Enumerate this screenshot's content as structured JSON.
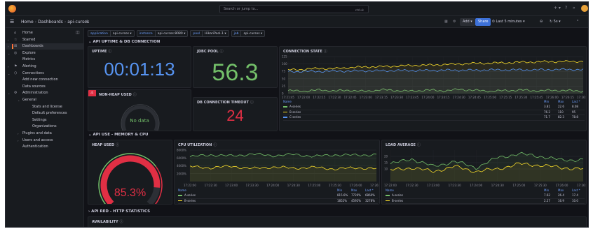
{
  "topbar": {
    "search_placeholder": "Search or jump to...",
    "search_shortcut": "ctrl+k",
    "help_label": "?",
    "news_label": "»"
  },
  "breadcrumb": {
    "home": "Home",
    "dashboards": "Dashboards",
    "current": "api-cursos"
  },
  "toolbar": {
    "add_label": "Add ▾",
    "share_label": "Share",
    "time_range": "Last 5 minutes ▾",
    "refresh_label": "5s ▾"
  },
  "sidebar": {
    "items": [
      {
        "label": "Home",
        "icon": "home-icon",
        "glyph": "⌂",
        "chev": ""
      },
      {
        "label": "Starred",
        "icon": "star-icon",
        "glyph": "☆",
        "chev": "›"
      },
      {
        "label": "Dashboards",
        "icon": "dashboards-icon",
        "glyph": "⊞",
        "chev": "›",
        "active": true
      },
      {
        "label": "Explore",
        "icon": "compass-icon",
        "glyph": "◎",
        "chev": "⌄"
      },
      {
        "label": "Metrics",
        "sub": true
      },
      {
        "label": "Alerting",
        "icon": "bell-icon",
        "glyph": "⚑",
        "chev": "›"
      },
      {
        "label": "Connections",
        "icon": "plug-icon",
        "glyph": "⬡",
        "chev": "⌄"
      },
      {
        "label": "Add new connection",
        "sub": true
      },
      {
        "label": "Data sources",
        "sub": true
      },
      {
        "label": "Administration",
        "icon": "gear-icon",
        "glyph": "⚙",
        "chev": "⌄"
      },
      {
        "label": "General",
        "sub": true,
        "chev": "⌄"
      },
      {
        "label": "Stats and license",
        "sub2": true
      },
      {
        "label": "Default preferences",
        "sub2": true
      },
      {
        "label": "Settings",
        "sub2": true
      },
      {
        "label": "Organizations",
        "sub2": true
      },
      {
        "label": "Plugins and data",
        "sub": true,
        "chev": "›"
      },
      {
        "label": "Users and access",
        "sub": true,
        "chev": "›"
      },
      {
        "label": "Authentication",
        "sub": true
      }
    ]
  },
  "variables": [
    {
      "key": "application",
      "value": "api-cursos ▾"
    },
    {
      "key": "instance",
      "value": "api-cursos:8080 ▾"
    },
    {
      "key": "pool",
      "value": "HikariPool-1 ▾"
    },
    {
      "key": "job",
      "value": "api-cursos ▾"
    }
  ],
  "rows": {
    "uptime_db": "⌄ API UPTIME & DB CONNECTION",
    "memory_cpu": "⌄ API USE - MEMORY & CPU",
    "red": "› API RED - HTTP STATISTICS"
  },
  "panels": {
    "uptime": {
      "title": "UPTIME",
      "value": "00:01:13"
    },
    "jdbc": {
      "title": "JDBC POOL",
      "value": "56.3"
    },
    "nonheap": {
      "title": "NON-HEAP USED",
      "value": "No data"
    },
    "db_timeout": {
      "title": "DB CONNECTION TIMEOUT",
      "value": "24"
    },
    "heap": {
      "title": "HEAP USED",
      "value": "85.3%"
    },
    "availability": {
      "title": "AVAILABILITY"
    },
    "connection_state": {
      "title": "CONNECTION STATE",
      "legend_headers": {
        "name": "Name",
        "min": "Min",
        "max": "Max",
        "last": "Last *"
      },
      "legend": [
        {
          "name": "A-series",
          "min": "3.81",
          "max": "22.6",
          "last": "8.08"
        },
        {
          "name": "B-series",
          "min": "76.2",
          "max": "110",
          "last": "95"
        },
        {
          "name": "C-series",
          "min": "71.7",
          "max": "82.3",
          "last": "78.8"
        }
      ]
    },
    "cpu": {
      "title": "CPU UTILIZATION",
      "legend_headers": {
        "name": "Name",
        "min": "Min",
        "max": "Max",
        "last": "Last *"
      },
      "legend": [
        {
          "name": "A-series",
          "min": "815.6%",
          "max": "7726%",
          "last": "6860%"
        },
        {
          "name": "B-series",
          "min": "1852%",
          "max": "4592%",
          "last": "3278%"
        }
      ]
    },
    "load": {
      "title": "LOAD AVERAGE",
      "legend_headers": {
        "name": "Name",
        "min": "Min",
        "max": "Max",
        "last": "Last *"
      },
      "legend": [
        {
          "name": "A-series",
          "min": "7.62",
          "max": "26.4",
          "last": "17.4"
        },
        {
          "name": "B-series",
          "min": "2.27",
          "max": "16.9",
          "last": "10.0"
        }
      ]
    }
  },
  "colors": {
    "green": "#73bf69",
    "yellow": "#fade2a",
    "blue": "#5794f2",
    "red": "#e02f44",
    "accent": "#3d71d9"
  },
  "chart_data": [
    {
      "type": "line",
      "title": "CONNECTION STATE",
      "x": [
        "17:21:45",
        "17:22:00",
        "17:22:15",
        "17:22:30",
        "17:22:45",
        "17:23:00",
        "17:23:15",
        "17:23:30",
        "17:23:45",
        "17:24:00",
        "17:24:15",
        "17:24:30",
        "17:24:45",
        "17:25:00",
        "17:25:15",
        "17:25:30",
        "17:25:45",
        "17:26:00",
        "17:26:15",
        "17:26:30"
      ],
      "ylim": [
        0,
        125
      ],
      "yticks": [
        "125",
        "100",
        "75",
        "50",
        "25",
        "0"
      ],
      "series": [
        {
          "name": "A-series",
          "color": "#73bf69",
          "values": [
            10,
            8,
            12,
            9,
            11,
            7,
            13,
            10,
            8,
            12,
            9,
            14,
            11,
            8,
            10,
            12,
            9,
            11,
            10,
            8
          ]
        },
        {
          "name": "B-series",
          "color": "#fade2a",
          "values": [
            80,
            82,
            85,
            84,
            88,
            90,
            91,
            93,
            95,
            96,
            98,
            100,
            102,
            103,
            104,
            106,
            107,
            108,
            108,
            109
          ]
        },
        {
          "name": "C-series",
          "color": "#5794f2",
          "values": [
            74,
            75,
            75,
            76,
            76,
            77,
            77,
            78,
            78,
            78,
            79,
            79,
            79,
            80,
            80,
            80,
            80,
            81,
            81,
            81
          ]
        }
      ]
    },
    {
      "type": "line",
      "title": "CPU UTILIZATION",
      "x": [
        "17:22:00",
        "17:22:30",
        "17:23:00",
        "17:23:30",
        "17:24:00",
        "17:24:30",
        "17:25:00",
        "17:25:30",
        "17:26:00",
        "17:26:30"
      ],
      "ylim": [
        0,
        8000
      ],
      "yticks": [
        "8000%",
        "6000%",
        "4000%",
        "2000%"
      ],
      "series": [
        {
          "name": "A-series",
          "color": "#73bf69",
          "values": [
            6300,
            6800,
            6500,
            7000,
            6600,
            6900,
            6400,
            6800,
            6700,
            6860
          ]
        },
        {
          "name": "B-series",
          "color": "#fade2a",
          "values": [
            3800,
            3500,
            3900,
            3300,
            3700,
            3400,
            3600,
            3200,
            3500,
            3278
          ]
        }
      ]
    },
    {
      "type": "line",
      "title": "LOAD AVERAGE",
      "x": [
        "17:22:00",
        "17:22:30",
        "17:23:00",
        "17:23:30",
        "17:24:00",
        "17:24:30",
        "17:25:00",
        "17:25:30",
        "17:26:00",
        "17:26:30"
      ],
      "ylim": [
        0,
        25
      ],
      "yticks": [
        "20",
        "15",
        "10"
      ],
      "series": [
        {
          "name": "A-series",
          "color": "#73bf69",
          "values": [
            14,
            18,
            12,
            16,
            11,
            19,
            22,
            20,
            17,
            17.4
          ]
        },
        {
          "name": "B-series",
          "color": "#fade2a",
          "values": [
            9,
            11,
            8,
            12,
            8,
            10,
            14,
            13,
            11,
            10.0
          ]
        }
      ]
    }
  ]
}
